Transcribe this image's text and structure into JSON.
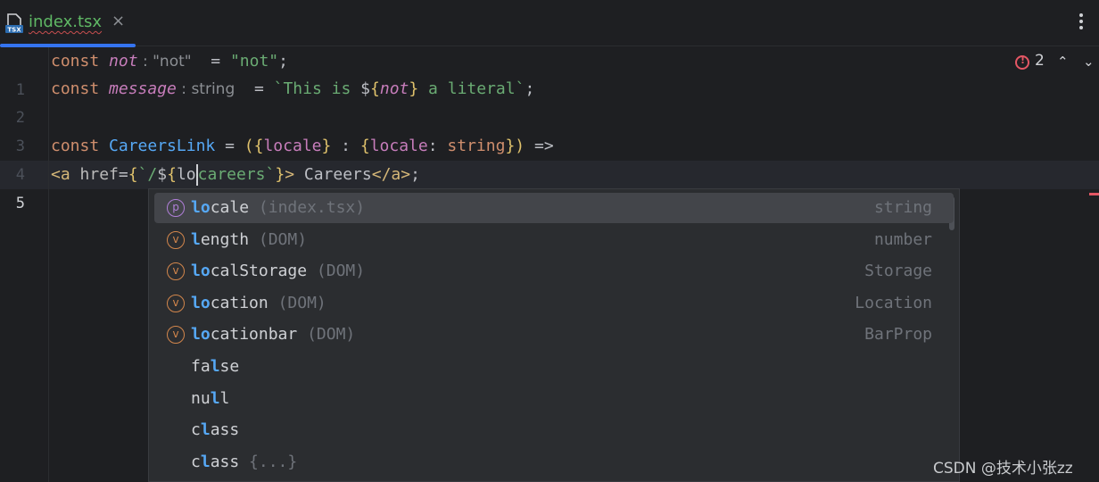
{
  "tab": {
    "file_badge": "TSX",
    "title": "index.tsx",
    "close": "×"
  },
  "editor": {
    "line_numbers": [
      "1",
      "2",
      "3",
      "4",
      "5"
    ],
    "line1": {
      "kw": "const",
      "var": "not",
      "hint_colon": ":",
      "hint_type": "\"not\"",
      "eq": "=",
      "value": "\"not\"",
      "semi": ";"
    },
    "line2": {
      "kw": "const",
      "var": "message",
      "hint_colon": ":",
      "hint_type": "string",
      "eq": "=",
      "tpl_start": "`This is ",
      "dollar": "$",
      "open": "{",
      "inner": "not",
      "close": "}",
      "tpl_end": " a literal`",
      "semi": ";"
    },
    "line4": {
      "kw": "const",
      "name": "CareersLink",
      "eq": "=",
      "p1": "(",
      "b1": "{",
      "locale": "locale",
      "b2": "}",
      "colon": " : ",
      "b3": "{",
      "locale2": "locale",
      "colon2": ": ",
      "type": "string",
      "b4": "}",
      "p2": ")",
      "arrow": "=>"
    },
    "line5": {
      "lt": "<",
      "tag": "a",
      "attr": "href",
      "eq": "=",
      "b1": "{",
      "tpl1": "`/",
      "dollar": "$",
      "b2": "{",
      "typed": "lo",
      "rest": "careers`",
      "b3": "}",
      "gt": ">",
      "text": " Careers",
      "close_tag": "</a>",
      "semi": ";"
    },
    "problems": {
      "count": "2",
      "up": "⌃",
      "down": "⌄"
    }
  },
  "completion": {
    "items": [
      {
        "kind": "p",
        "match": "lo",
        "rest": "cale",
        "location": "(index.tsx)",
        "type": "string"
      },
      {
        "kind": "v",
        "match": "l",
        "rest": "ength",
        "location": "(DOM)",
        "type": "number"
      },
      {
        "kind": "v",
        "match": "lo",
        "rest": "calStorage",
        "location": "(DOM)",
        "type": "Storage"
      },
      {
        "kind": "v",
        "match": "lo",
        "rest": "cation",
        "location": "(DOM)",
        "type": "Location"
      },
      {
        "kind": "v",
        "match": "lo",
        "rest": "cationbar",
        "location": "(DOM)",
        "type": "BarProp"
      },
      {
        "kind": "",
        "pre": "fa",
        "match": "l",
        "rest": "se",
        "location": "",
        "type": ""
      },
      {
        "kind": "",
        "pre": "nu",
        "match": "l",
        "rest": "l",
        "location": "",
        "type": ""
      },
      {
        "kind": "",
        "pre": "c",
        "match": "l",
        "rest": "ass",
        "location": "",
        "type": ""
      },
      {
        "kind": "",
        "pre": "c",
        "match": "l",
        "rest": "ass",
        "location": "{...}",
        "type": ""
      }
    ]
  },
  "watermark": "CSDN @技术小张zz",
  "colors": {
    "accent": "#3574f0",
    "error": "#e55765",
    "match": "#56a8f5"
  }
}
